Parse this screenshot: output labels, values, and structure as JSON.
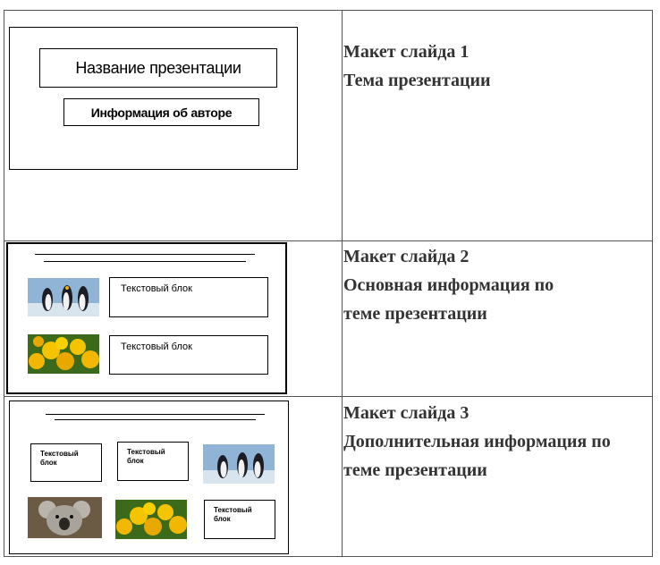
{
  "layouts": [
    {
      "line1": "Макет слайда 1",
      "line2": "Тема презентации",
      "slide": {
        "title": "Название презентации",
        "author": "Информация об авторе"
      }
    },
    {
      "line1": "Макет слайда 2",
      "line2": "Основная информация по",
      "line3": "теме презентации",
      "slide": {
        "block1": "Текстовый блок",
        "block2": "Текстовый блок"
      }
    },
    {
      "line1": "Макет слайда 3",
      "line2": "Дополнительная информация по",
      "line3": "теме презентации",
      "slide": {
        "block_line1": "Текстовый",
        "block_line2": "блок"
      }
    }
  ],
  "pictures": {
    "penguins": "penguins-photo",
    "flowers": "yellow-flowers-photo",
    "koala": "koala-photo"
  }
}
